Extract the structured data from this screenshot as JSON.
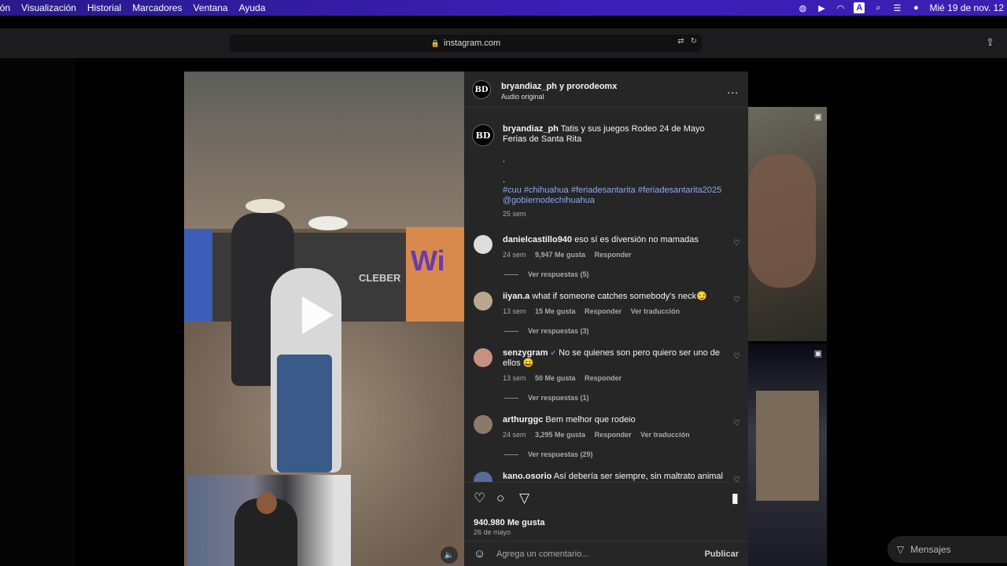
{
  "menubar": {
    "items": [
      "ión",
      "Visualización",
      "Historial",
      "Marcadores",
      "Ventana",
      "Ayuda"
    ],
    "clock": "Mié 19 de nov.  12"
  },
  "browser": {
    "url": "instagram.com"
  },
  "post": {
    "header_name": "bryandiaz_ph y prorodeomx",
    "header_sub": "Audio original",
    "more_icon": "...",
    "caption": {
      "user": "bryandiaz_ph",
      "text": "Tatis y sus juegos Rodeo 24 de Mayo Ferias de Santa Rita",
      "dot1": ".",
      "dot2": ".",
      "hashtags": "#cuu #chihuahua #feriadesantarita #feriadesantarita2025 @gobiernodechihuahua",
      "time": "25 sem"
    },
    "comments": [
      {
        "user": "danielcastillo940",
        "text": "eso sí es diversión no mamadas",
        "time": "24 sem",
        "likes": "9,947 Me gusta",
        "reply": "Responder",
        "translate": "",
        "view_replies": "Ver respuestas (5)"
      },
      {
        "user": "iiyan.a",
        "text": "what if someone catches somebody's neck😏",
        "time": "13 sem",
        "likes": "15 Me gusta",
        "reply": "Responder",
        "translate": "Ver traducción",
        "view_replies": "Ver respuestas (3)"
      },
      {
        "user": "senzygram",
        "text": "No se quienes son pero quiero ser uno de ellos 😄",
        "time": "13 sem",
        "likes": "50 Me gusta",
        "reply": "Responder",
        "translate": "",
        "view_replies": "Ver respuestas (1)"
      },
      {
        "user": "arthurggc",
        "text": "Bem melhor que rodeio",
        "time": "24 sem",
        "likes": "3,295 Me gusta",
        "reply": "Responder",
        "translate": "Ver traducción",
        "view_replies": "Ver respuestas (29)"
      },
      {
        "user": "kano.osorio",
        "text": "Así debería ser siempre, sin maltrato animal",
        "time": "",
        "likes": "",
        "reply": "",
        "translate": "",
        "view_replies": ""
      }
    ],
    "likes_total": "940.980 Me gusta",
    "date": "26 de mayo",
    "comment_placeholder": "Agrega un comentario...",
    "publish_label": "Publicar"
  },
  "video": {
    "banner_text": "CLEBER",
    "banner_wi": "Wi"
  },
  "messages": {
    "label": "Mensajes"
  },
  "colors": {
    "panel_bg": "#262626",
    "hashtag": "#8ca8f0",
    "menubar": "#3b1fb8"
  }
}
